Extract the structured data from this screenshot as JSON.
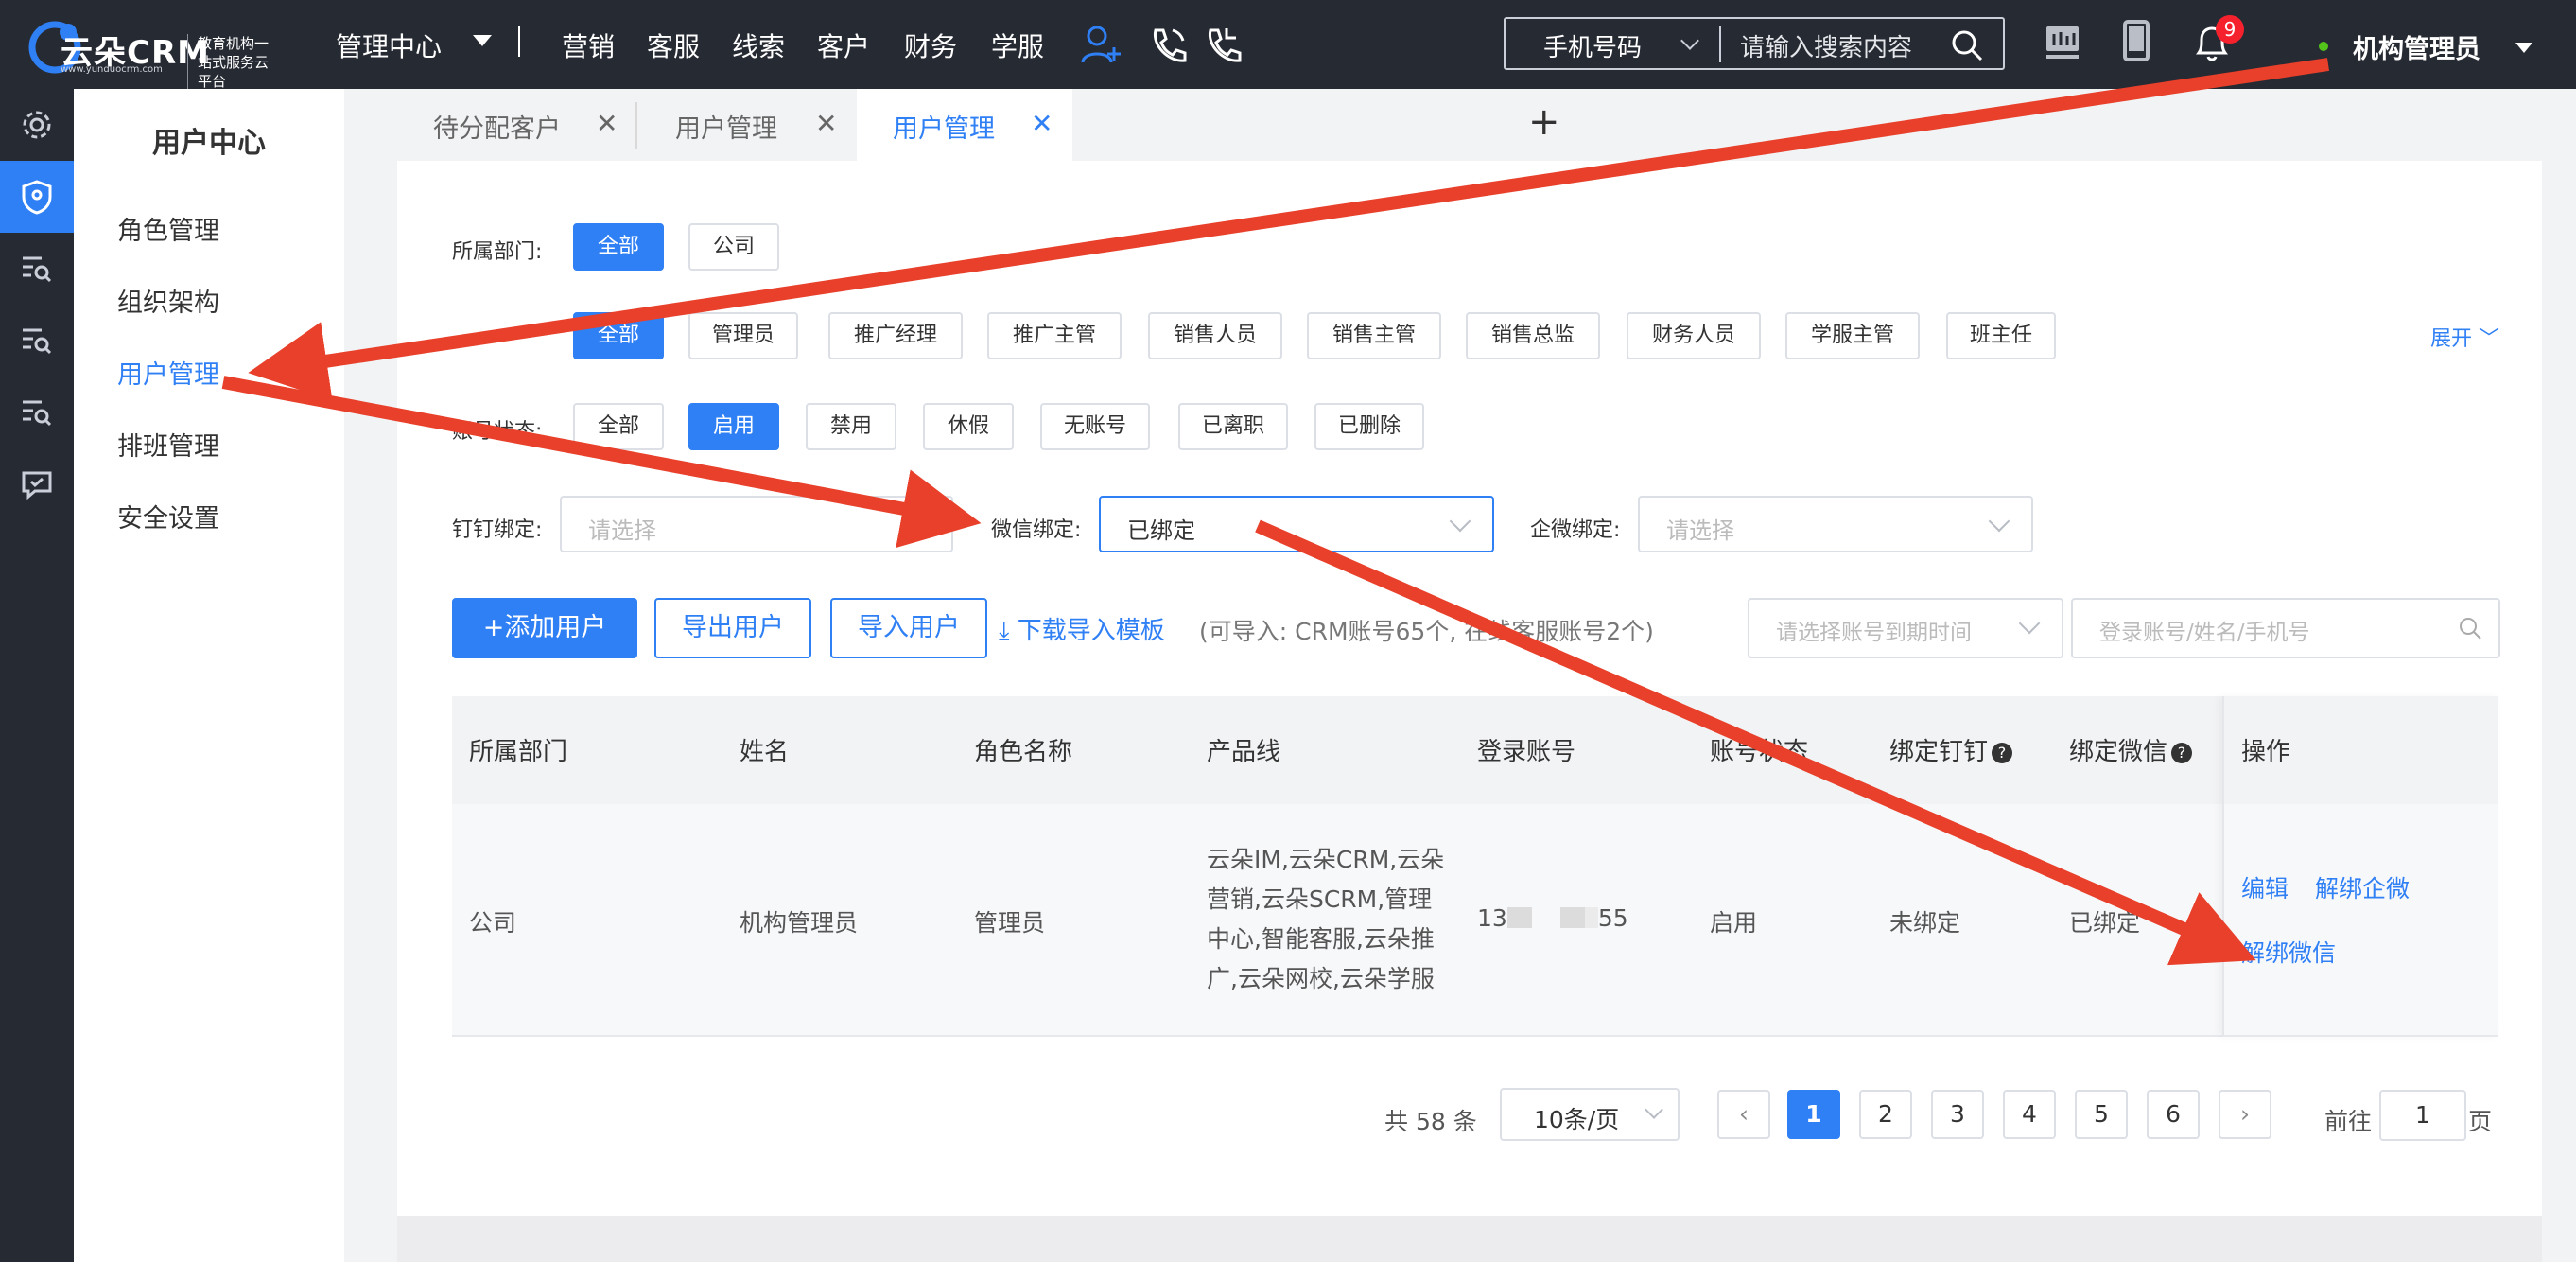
{
  "app": {
    "brand": "云朵CRM",
    "brand_url": "www.yunduocrm.com",
    "slogan": "教育机构一站式服务云平台"
  },
  "topnav": {
    "management_center": "管理中心",
    "items": [
      "营销",
      "客服",
      "线索",
      "客户",
      "财务",
      "学服"
    ],
    "search_type": "手机号码",
    "search_placeholder": "请输入搜索内容",
    "notification_count": "9",
    "user_name": "机构管理员"
  },
  "sidebar": {
    "title": "用户中心",
    "items": [
      {
        "label": "角色管理"
      },
      {
        "label": "组织架构"
      },
      {
        "label": "用户管理"
      },
      {
        "label": "排班管理"
      },
      {
        "label": "安全设置"
      }
    ]
  },
  "tabs": [
    {
      "label": "待分配客户"
    },
    {
      "label": "用户管理"
    },
    {
      "label": "用户管理"
    }
  ],
  "filters": {
    "dept_label": "所属部门:",
    "dept_options": [
      "全部",
      "公司"
    ],
    "role_options": [
      "全部",
      "管理员",
      "推广经理",
      "推广主管",
      "销售人员",
      "销售主管",
      "销售总监",
      "财务人员",
      "学服主管",
      "班主任"
    ],
    "expand_label": "展开",
    "status_label": "账号状态:",
    "status_options": [
      "全部",
      "启用",
      "禁用",
      "休假",
      "无账号",
      "已离职",
      "已删除"
    ],
    "dingtalk_label": "钉钉绑定:",
    "dingtalk_placeholder": "请选择",
    "wechat_label": "微信绑定:",
    "wechat_value": "已绑定",
    "wecom_label": "企微绑定:",
    "wecom_placeholder": "请选择"
  },
  "actions": {
    "add_user": "+添加用户",
    "export_user": "导出用户",
    "import_user": "导入用户",
    "download_template": "下载导入模板",
    "import_note": "(可导入: CRM账号65个, 在线客服账号2个)",
    "expiry_placeholder": "请选择账号到期时间",
    "search_placeholder": "登录账号/姓名/手机号"
  },
  "table": {
    "headers": [
      "所属部门",
      "姓名",
      "角色名称",
      "产品线",
      "登录账号",
      "账号状态",
      "绑定钉钉",
      "绑定微信",
      "操作"
    ],
    "rows": [
      {
        "dept": "公司",
        "name": "机构管理员",
        "role": "管理员",
        "product_lines": [
          "云朵IM,云朵CRM,云朵",
          "营销,云朵SCRM,管理",
          "中心,智能客服,云朵推",
          "广,云朵网校,云朵学服"
        ],
        "account_prefix": "13",
        "account_suffix": "55",
        "status": "启用",
        "dingtalk": "未绑定",
        "wechat": "已绑定",
        "ops": [
          "编辑",
          "解绑企微",
          "解绑微信"
        ]
      }
    ]
  },
  "pager": {
    "total": "共 58 条",
    "page_size": "10条/页",
    "pages": [
      "1",
      "2",
      "3",
      "4",
      "5",
      "6"
    ],
    "current": "1",
    "goto_label": "前往",
    "goto_value": "1",
    "goto_unit": "页"
  },
  "colors": {
    "accent": "#2f7ff5",
    "topbar": "#262a33",
    "annotation_arrow": "#e8402a"
  }
}
